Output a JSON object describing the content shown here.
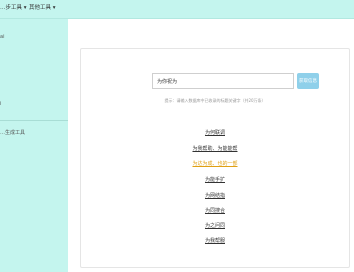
{
  "top_menu": {
    "item1": "…步工具 ▾",
    "item2": "其他工具 ▾"
  },
  "sidebar": {
    "item_top": "ai",
    "item_mid": "i",
    "item_bottom": "…生成工具"
  },
  "search": {
    "input_value": "为你祝为",
    "button_label": "获取信息",
    "hint": "提示：请输入数据库中已收录的标题关键字（共20万条）"
  },
  "results": [
    "为何联调",
    "为我帮助、为能能帮",
    "为达为成、也的一部",
    "为能手扩",
    "为网结指",
    "为同搜合",
    "为之问同",
    "为我帮服"
  ],
  "colors": {
    "background": "#c4f5ee",
    "button": "#8fd0ea",
    "active_link": "#e0a013"
  }
}
